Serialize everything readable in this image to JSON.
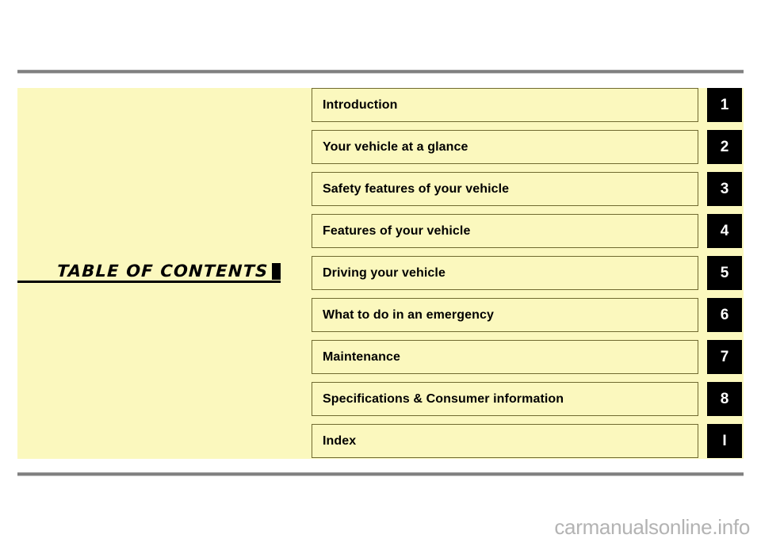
{
  "page": {
    "title": "TABLE OF CONTENTS",
    "watermark": "carmanualsonline.info",
    "colors": {
      "panel_background": "#FBF8BE",
      "row_border": "#706a30",
      "badge_background": "#000000",
      "badge_text": "#FFFFFF",
      "rule": "#808080",
      "watermark_text": "#B3B3B3"
    }
  },
  "contents": {
    "rows": [
      {
        "label": "Introduction",
        "badge": "1"
      },
      {
        "label": "Your vehicle at a glance",
        "badge": "2"
      },
      {
        "label": "Safety features of your vehicle",
        "badge": "3"
      },
      {
        "label": "Features of your vehicle",
        "badge": "4"
      },
      {
        "label": "Driving your vehicle",
        "badge": "5"
      },
      {
        "label": "What to do in an emergency",
        "badge": "6"
      },
      {
        "label": "Maintenance",
        "badge": "7"
      },
      {
        "label": "Specifications & Consumer information",
        "badge": "8"
      },
      {
        "label": "Index",
        "badge": "I"
      }
    ]
  }
}
